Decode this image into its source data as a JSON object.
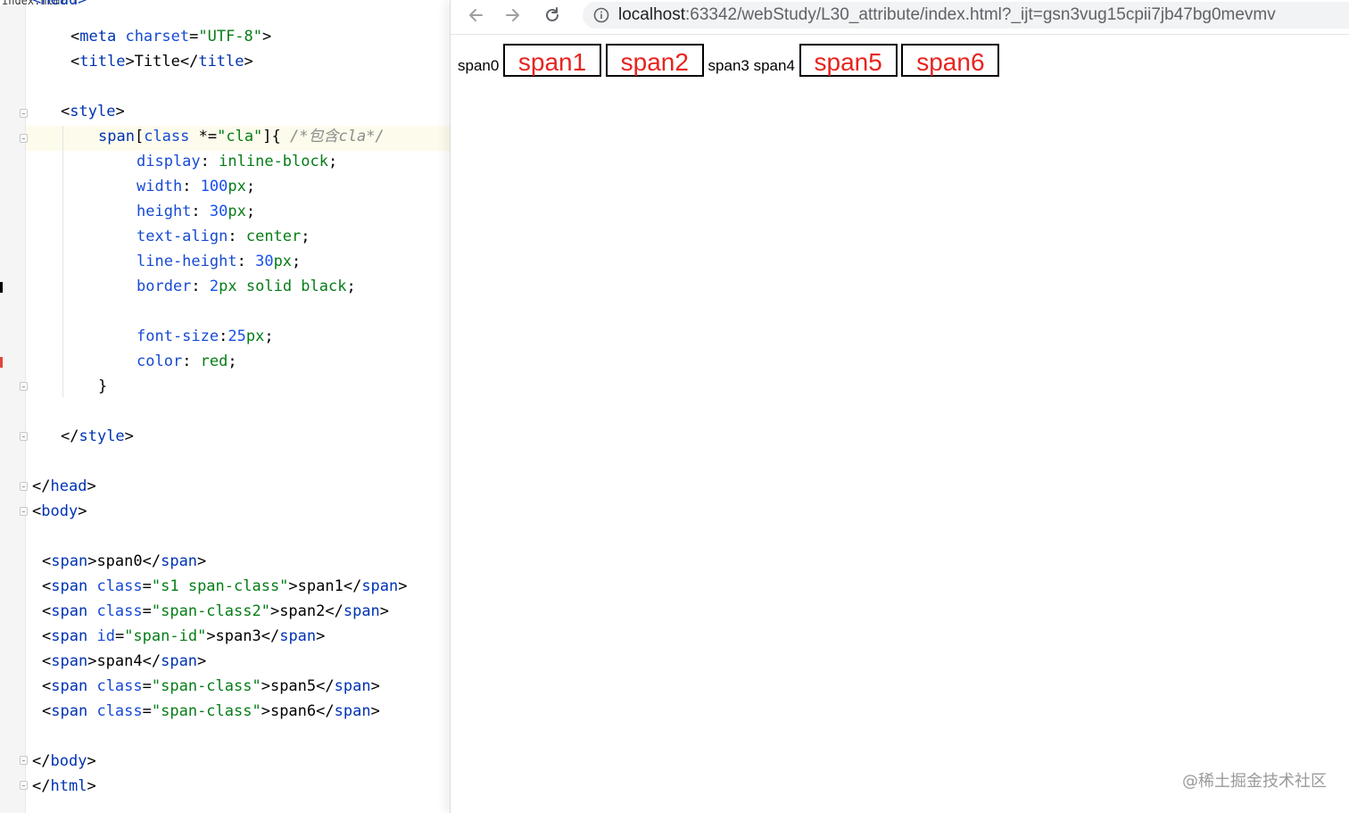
{
  "editor": {
    "tab_label": "index.html",
    "close_glyph": "×",
    "lines": [
      {
        "tokens": [
          {
            "c": "tag",
            "t": "<head>"
          }
        ]
      },
      {
        "tokens": [
          {
            "c": "ink",
            "t": "<"
          },
          {
            "c": "tag",
            "t": "meta"
          },
          {
            "c": "ink",
            "t": " "
          },
          {
            "c": "att",
            "t": "charset"
          },
          {
            "c": "ink",
            "t": "="
          },
          {
            "c": "str",
            "t": "\"UTF-8\""
          },
          {
            "c": "ink",
            "t": ">"
          }
        ]
      },
      {
        "tokens": [
          {
            "c": "ink",
            "t": "<"
          },
          {
            "c": "tag",
            "t": "title"
          },
          {
            "c": "ink",
            "t": ">Title</"
          },
          {
            "c": "tag",
            "t": "title"
          },
          {
            "c": "ink",
            "t": ">"
          }
        ]
      },
      {
        "tokens": []
      },
      {
        "tokens": [
          {
            "c": "ink",
            "t": "<"
          },
          {
            "c": "tag",
            "t": "style"
          },
          {
            "c": "ink",
            "t": ">"
          }
        ]
      },
      {
        "tokens": [
          {
            "c": "sel-tag",
            "t": "span"
          },
          {
            "c": "ink",
            "t": "["
          },
          {
            "c": "att",
            "t": "class"
          },
          {
            "c": "ink",
            "t": " *="
          },
          {
            "c": "str",
            "t": "\"cla\""
          },
          {
            "c": "ink",
            "t": "]{ "
          },
          {
            "c": "cmt",
            "t": "/*包含cla*/"
          }
        ]
      },
      {
        "tokens": [
          {
            "c": "prop",
            "t": "display"
          },
          {
            "c": "ink",
            "t": ": "
          },
          {
            "c": "val",
            "t": "inline-block"
          },
          {
            "c": "ink",
            "t": ";"
          }
        ]
      },
      {
        "tokens": [
          {
            "c": "prop",
            "t": "width"
          },
          {
            "c": "ink",
            "t": ": "
          },
          {
            "c": "num",
            "t": "100"
          },
          {
            "c": "unit",
            "t": "px"
          },
          {
            "c": "ink",
            "t": ";"
          }
        ]
      },
      {
        "tokens": [
          {
            "c": "prop",
            "t": "height"
          },
          {
            "c": "ink",
            "t": ": "
          },
          {
            "c": "num",
            "t": "30"
          },
          {
            "c": "unit",
            "t": "px"
          },
          {
            "c": "ink",
            "t": ";"
          }
        ]
      },
      {
        "tokens": [
          {
            "c": "prop",
            "t": "text-align"
          },
          {
            "c": "ink",
            "t": ": "
          },
          {
            "c": "val",
            "t": "center"
          },
          {
            "c": "ink",
            "t": ";"
          }
        ]
      },
      {
        "tokens": [
          {
            "c": "prop",
            "t": "line-height"
          },
          {
            "c": "ink",
            "t": ": "
          },
          {
            "c": "num",
            "t": "30"
          },
          {
            "c": "unit",
            "t": "px"
          },
          {
            "c": "ink",
            "t": ";"
          }
        ]
      },
      {
        "tokens": [
          {
            "c": "prop",
            "t": "border"
          },
          {
            "c": "ink",
            "t": ": "
          },
          {
            "c": "num",
            "t": "2"
          },
          {
            "c": "unit",
            "t": "px"
          },
          {
            "c": "ink",
            "t": " "
          },
          {
            "c": "val",
            "t": "solid black"
          },
          {
            "c": "ink",
            "t": ";"
          }
        ]
      },
      {
        "tokens": []
      },
      {
        "tokens": [
          {
            "c": "prop",
            "t": "font-size"
          },
          {
            "c": "ink",
            "t": ":"
          },
          {
            "c": "num",
            "t": "25"
          },
          {
            "c": "unit",
            "t": "px"
          },
          {
            "c": "ink",
            "t": ";"
          }
        ]
      },
      {
        "tokens": [
          {
            "c": "prop",
            "t": "color"
          },
          {
            "c": "ink",
            "t": ": "
          },
          {
            "c": "val",
            "t": "red"
          },
          {
            "c": "ink",
            "t": ";"
          }
        ]
      },
      {
        "tokens": [
          {
            "c": "ink",
            "t": "}"
          }
        ]
      },
      {
        "tokens": []
      },
      {
        "tokens": [
          {
            "c": "ink",
            "t": "</"
          },
          {
            "c": "tag",
            "t": "style"
          },
          {
            "c": "ink",
            "t": ">"
          }
        ]
      },
      {
        "tokens": []
      },
      {
        "tokens": [
          {
            "c": "ink",
            "t": "</"
          },
          {
            "c": "tag",
            "t": "head"
          },
          {
            "c": "ink",
            "t": ">"
          }
        ]
      },
      {
        "tokens": [
          {
            "c": "ink",
            "t": "<"
          },
          {
            "c": "tag",
            "t": "body"
          },
          {
            "c": "ink",
            "t": ">"
          }
        ]
      },
      {
        "tokens": []
      },
      {
        "tokens": [
          {
            "c": "ink",
            "t": "<"
          },
          {
            "c": "tag",
            "t": "span"
          },
          {
            "c": "ink",
            "t": ">span0</"
          },
          {
            "c": "tag",
            "t": "span"
          },
          {
            "c": "ink",
            "t": ">"
          }
        ]
      },
      {
        "tokens": [
          {
            "c": "ink",
            "t": "<"
          },
          {
            "c": "tag",
            "t": "span"
          },
          {
            "c": "ink",
            "t": " "
          },
          {
            "c": "att",
            "t": "class"
          },
          {
            "c": "ink",
            "t": "="
          },
          {
            "c": "str",
            "t": "\"s1 span-class\""
          },
          {
            "c": "ink",
            "t": ">span1</"
          },
          {
            "c": "tag",
            "t": "span"
          },
          {
            "c": "ink",
            "t": ">"
          }
        ]
      },
      {
        "tokens": [
          {
            "c": "ink",
            "t": "<"
          },
          {
            "c": "tag",
            "t": "span"
          },
          {
            "c": "ink",
            "t": " "
          },
          {
            "c": "att",
            "t": "class"
          },
          {
            "c": "ink",
            "t": "="
          },
          {
            "c": "str",
            "t": "\"span-class2\""
          },
          {
            "c": "ink",
            "t": ">span2</"
          },
          {
            "c": "tag",
            "t": "span"
          },
          {
            "c": "ink",
            "t": ">"
          }
        ]
      },
      {
        "tokens": [
          {
            "c": "ink",
            "t": "<"
          },
          {
            "c": "tag",
            "t": "span"
          },
          {
            "c": "ink",
            "t": " "
          },
          {
            "c": "att",
            "t": "id"
          },
          {
            "c": "ink",
            "t": "="
          },
          {
            "c": "str",
            "t": "\"span-id\""
          },
          {
            "c": "ink",
            "t": ">span3</"
          },
          {
            "c": "tag",
            "t": "span"
          },
          {
            "c": "ink",
            "t": ">"
          }
        ]
      },
      {
        "tokens": [
          {
            "c": "ink",
            "t": "<"
          },
          {
            "c": "tag",
            "t": "span"
          },
          {
            "c": "ink",
            "t": ">span4</"
          },
          {
            "c": "tag",
            "t": "span"
          },
          {
            "c": "ink",
            "t": ">"
          }
        ]
      },
      {
        "tokens": [
          {
            "c": "ink",
            "t": "<"
          },
          {
            "c": "tag",
            "t": "span"
          },
          {
            "c": "ink",
            "t": " "
          },
          {
            "c": "att",
            "t": "class"
          },
          {
            "c": "ink",
            "t": "="
          },
          {
            "c": "str",
            "t": "\"span-class\""
          },
          {
            "c": "ink",
            "t": ">span5</"
          },
          {
            "c": "tag",
            "t": "span"
          },
          {
            "c": "ink",
            "t": ">"
          }
        ]
      },
      {
        "tokens": [
          {
            "c": "ink",
            "t": "<"
          },
          {
            "c": "tag",
            "t": "span"
          },
          {
            "c": "ink",
            "t": " "
          },
          {
            "c": "att",
            "t": "class"
          },
          {
            "c": "ink",
            "t": "="
          },
          {
            "c": "str",
            "t": "\"span-class\""
          },
          {
            "c": "ink",
            "t": ">span6</"
          },
          {
            "c": "tag",
            "t": "span"
          },
          {
            "c": "ink",
            "t": ">"
          }
        ]
      },
      {
        "tokens": []
      },
      {
        "tokens": [
          {
            "c": "ink",
            "t": "</"
          },
          {
            "c": "tag",
            "t": "body"
          },
          {
            "c": "ink",
            "t": ">"
          }
        ]
      },
      {
        "tokens": [
          {
            "c": "ink",
            "t": "</"
          },
          {
            "c": "tag",
            "t": "html"
          },
          {
            "c": "ink",
            "t": ">"
          }
        ]
      }
    ]
  },
  "browser": {
    "back_icon": "arrow-left-icon",
    "forward_icon": "arrow-right-icon",
    "reload_icon": "reload-icon",
    "site_info_icon": "info-icon",
    "url_host": "localhost",
    "url_rest": ":63342/webStudy/L30_attribute/index.html?_ijt=gsn3vug15cpii7jb47bg0mevmv",
    "spans": [
      {
        "text": "span0",
        "boxed": false
      },
      {
        "text": "span1",
        "boxed": true
      },
      {
        "text": "span2",
        "boxed": true
      },
      {
        "text": "span3",
        "boxed": false
      },
      {
        "text": "span4",
        "boxed": false
      },
      {
        "text": "span5",
        "boxed": true
      },
      {
        "text": "span6",
        "boxed": true
      }
    ]
  },
  "watermark": "@稀土掘金技术社区",
  "colors": {
    "boxed_text": "#e8231f",
    "tag": "#0033b3",
    "string": "#067d17",
    "comment": "#8c8c8c"
  }
}
